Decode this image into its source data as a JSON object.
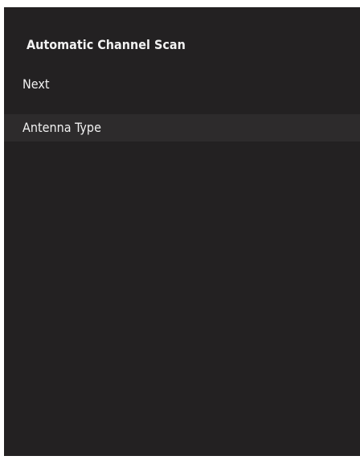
{
  "screen": {
    "title": "Automatic Channel Scan",
    "items": [
      {
        "label": "Next",
        "highlighted": false
      },
      {
        "label": "Antenna Type",
        "highlighted": true
      }
    ]
  },
  "colors": {
    "background": "#232122",
    "highlight": "#2d2b2c",
    "text": "#f2f2f2"
  }
}
